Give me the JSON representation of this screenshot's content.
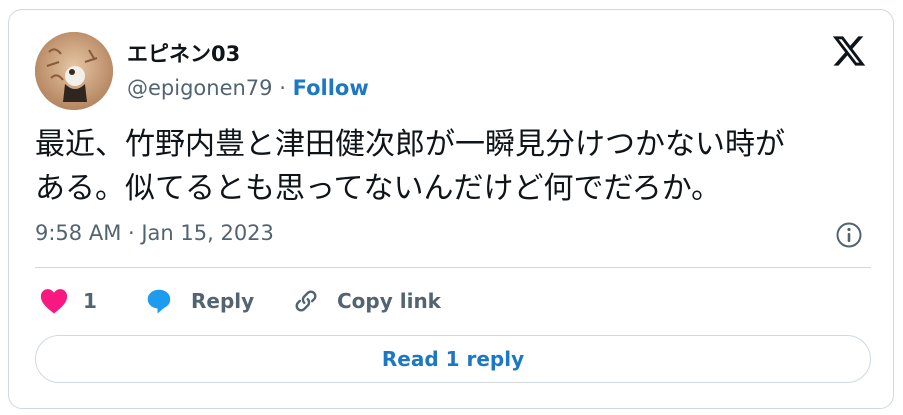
{
  "author": {
    "display_name": "エピネン03",
    "handle": "@epigonen79",
    "separator": "·",
    "follow_label": "Follow",
    "avatar_icon": "avatar-portrait",
    "follow_color": "#1d78c4"
  },
  "platform_icon": "x-logo-icon",
  "tweet": {
    "text_line1": "最近、竹野内豊と津田健次郎が一瞬見分けつかない時が",
    "text_line2": "ある。似てるとも思ってないんだけど何でだろか。",
    "timestamp": "9:58 AM · Jan 15, 2023"
  },
  "actions": {
    "like_count": "1",
    "like_color": "#f91880",
    "reply_label": "Reply",
    "reply_icon_color": "#1d9bf0",
    "copy_link_label": "Copy link"
  },
  "read_replies_label": "Read 1 reply"
}
